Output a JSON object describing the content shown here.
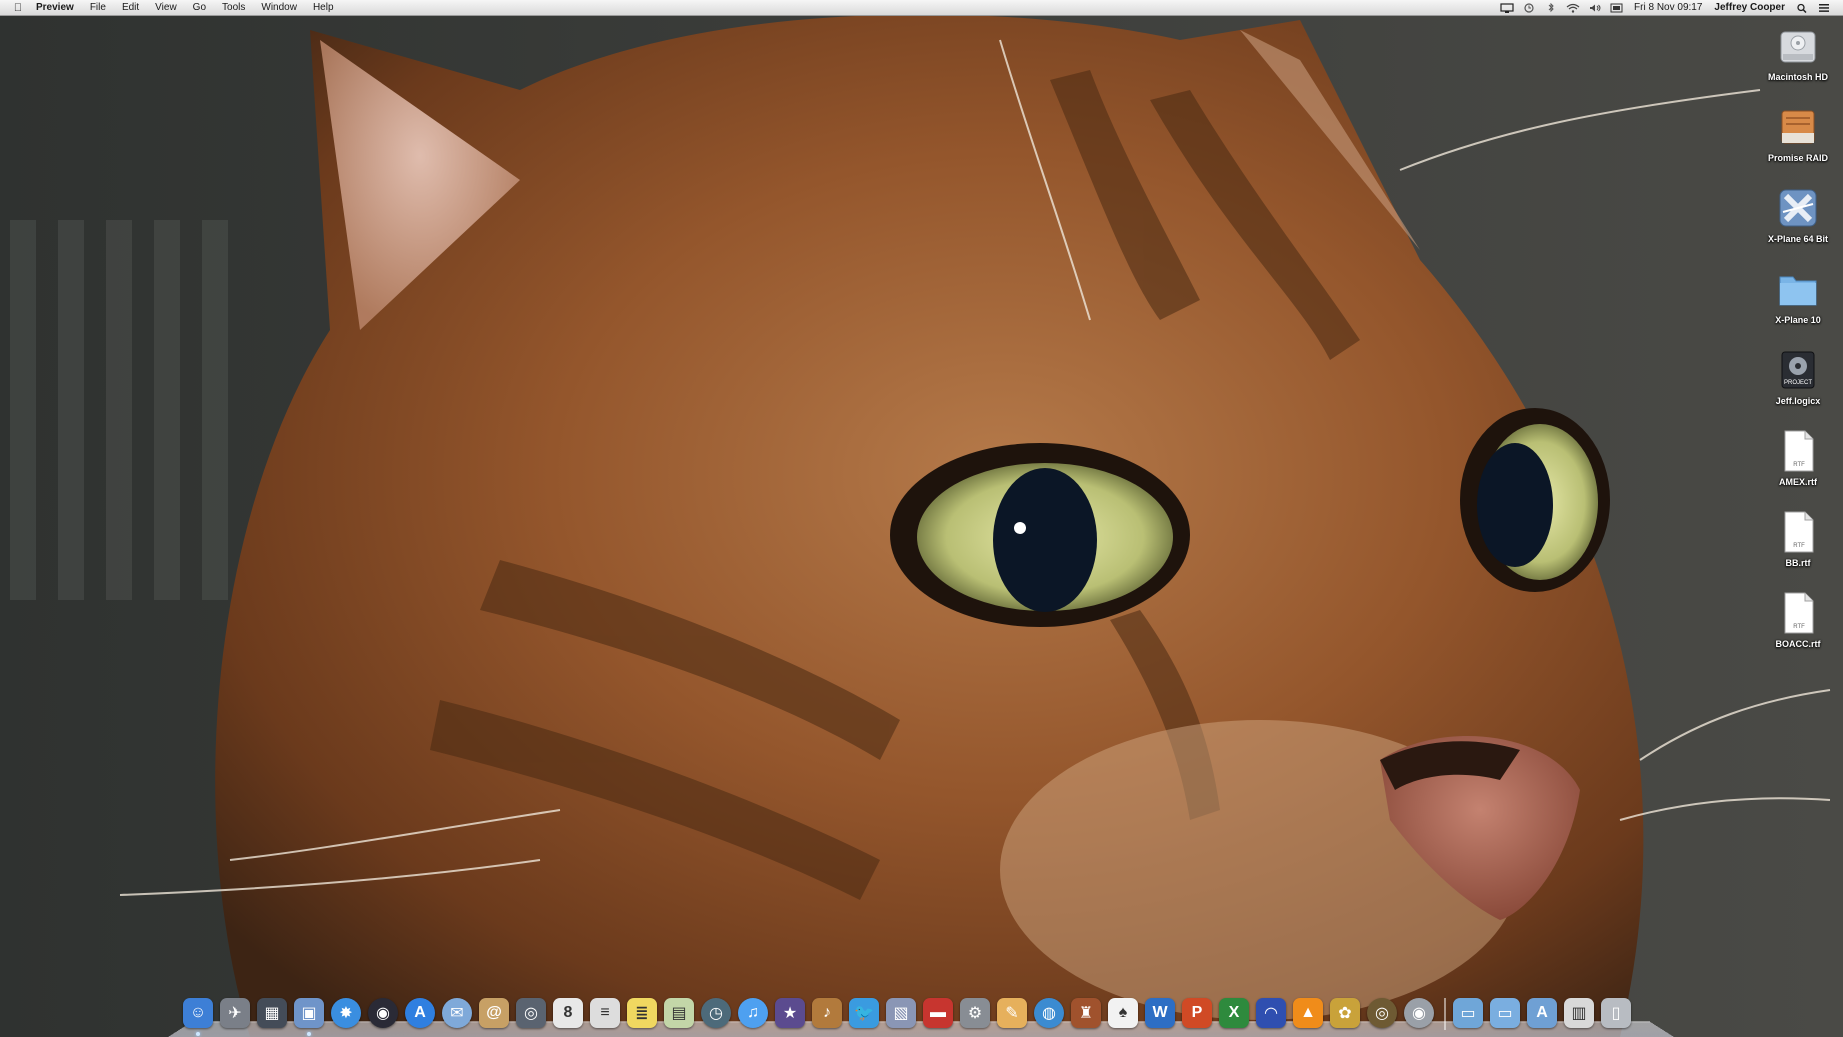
{
  "menubar": {
    "app_name": "Preview",
    "menus": [
      "File",
      "Edit",
      "View",
      "Go",
      "Tools",
      "Window",
      "Help"
    ],
    "clock": "Fri 8 Nov  09:17",
    "user": "Jeffrey Cooper",
    "status_icons": [
      "display-icon",
      "time-machine-icon",
      "bluetooth-icon",
      "wifi-icon",
      "volume-icon",
      "battery-icon"
    ]
  },
  "desktop": {
    "items": [
      {
        "label": "Macintosh HD",
        "icon": "hard-drive-icon"
      },
      {
        "label": "Promise RAID",
        "icon": "external-drive-icon"
      },
      {
        "label": "X-Plane 64 Bit",
        "icon": "xplane-app-icon"
      },
      {
        "label": "X-Plane 10",
        "icon": "folder-icon"
      },
      {
        "label": "Jeff.logicx",
        "icon": "logic-project-icon"
      },
      {
        "label": "AMEX.rtf",
        "icon": "rtf-document-icon"
      },
      {
        "label": "BB.rtf",
        "icon": "rtf-document-icon"
      },
      {
        "label": "BOACC.rtf",
        "icon": "rtf-document-icon"
      }
    ],
    "rtf_badge": "RTF",
    "project_badge": "PROJECT"
  },
  "dock": {
    "items": [
      {
        "icon": "finder-icon",
        "color": "#3d7fd6",
        "glyph": "☺",
        "running": true
      },
      {
        "icon": "launchpad-icon",
        "color": "#7a7f88",
        "glyph": "✈",
        "running": false
      },
      {
        "icon": "mission-control-icon",
        "color": "#444c58",
        "glyph": "▦",
        "running": false
      },
      {
        "icon": "preview-icon",
        "color": "#6f94c9",
        "glyph": "▣",
        "running": true
      },
      {
        "icon": "safari-icon",
        "color": "#3a8ee0",
        "glyph": "✸",
        "running": false,
        "round": true
      },
      {
        "icon": "aperture-icon",
        "color": "#2a2a36",
        "glyph": "◉",
        "running": false,
        "round": true
      },
      {
        "icon": "app-store-icon",
        "color": "#2f7fe0",
        "glyph": "A",
        "running": false,
        "round": true
      },
      {
        "icon": "mail-bird-icon",
        "color": "#7fa9d9",
        "glyph": "✉",
        "running": false,
        "round": true
      },
      {
        "icon": "address-book-icon",
        "color": "#c7a065",
        "glyph": "@",
        "running": false
      },
      {
        "icon": "facetime-icon",
        "color": "#5a6370",
        "glyph": "◎",
        "running": false
      },
      {
        "icon": "calendar-icon",
        "color": "#e8e8e8",
        "glyph": "8",
        "running": false
      },
      {
        "icon": "textedit-icon",
        "color": "#dddddd",
        "glyph": "≡",
        "running": false
      },
      {
        "icon": "stickies-icon",
        "color": "#f0d860",
        "glyph": "≣",
        "running": false
      },
      {
        "icon": "iphoto-icon",
        "color": "#c3d6a8",
        "glyph": "▤",
        "running": false
      },
      {
        "icon": "time-machine-icon",
        "color": "#4d6a7a",
        "glyph": "◷",
        "running": false,
        "round": true
      },
      {
        "icon": "itunes-icon",
        "color": "#4ea0f0",
        "glyph": "♫",
        "running": false,
        "round": true
      },
      {
        "icon": "imovie-icon",
        "color": "#5b4b8f",
        "glyph": "★",
        "running": false
      },
      {
        "icon": "garageband-icon",
        "color": "#b27a3c",
        "glyph": "♪",
        "running": false
      },
      {
        "icon": "twitter-icon",
        "color": "#3a9be0",
        "glyph": "🐦",
        "running": false
      },
      {
        "icon": "photo-booth-icon",
        "color": "#8a96b5",
        "glyph": "▧",
        "running": false
      },
      {
        "icon": "photo-stack-icon",
        "color": "#c7352f",
        "glyph": "▬",
        "running": false
      },
      {
        "icon": "system-preferences-icon",
        "color": "#888d94",
        "glyph": "⚙",
        "running": false
      },
      {
        "icon": "pages-icon",
        "color": "#e6b05c",
        "glyph": "✎",
        "running": false
      },
      {
        "icon": "network-globe-icon",
        "color": "#3b8bd1",
        "glyph": "◍",
        "running": false,
        "round": true
      },
      {
        "icon": "games-icon",
        "color": "#a0522d",
        "glyph": "♜",
        "running": false
      },
      {
        "icon": "solitaire-icon",
        "color": "#f2f2f2",
        "glyph": "♠",
        "running": false
      },
      {
        "icon": "word-icon",
        "color": "#2d6ec4",
        "glyph": "W",
        "running": false
      },
      {
        "icon": "powerpoint-icon",
        "color": "#d04a25",
        "glyph": "P",
        "running": false
      },
      {
        "icon": "excel-icon",
        "color": "#2e8a3d",
        "glyph": "X",
        "running": false
      },
      {
        "icon": "headphones-icon",
        "color": "#2f4fb0",
        "glyph": "◠",
        "running": false
      },
      {
        "icon": "vlc-icon",
        "color": "#f08c1a",
        "glyph": "▲",
        "running": false
      },
      {
        "icon": "pineapple-icon",
        "color": "#c9a23a",
        "glyph": "✿",
        "running": false
      },
      {
        "icon": "coin-icon",
        "color": "#6e5a33",
        "glyph": "◎",
        "running": false,
        "round": true
      },
      {
        "icon": "dvd-player-icon",
        "color": "#9aa0a8",
        "glyph": "◉",
        "running": false,
        "round": true
      },
      {
        "sep": true
      },
      {
        "icon": "applications-stack-icon",
        "color": "#6fa6d8",
        "glyph": "▭",
        "running": false
      },
      {
        "icon": "documents-stack-icon",
        "color": "#7aaee0",
        "glyph": "▭",
        "running": false
      },
      {
        "icon": "downloads-stack-icon",
        "color": "#6fa0d4",
        "glyph": "A",
        "running": false
      },
      {
        "icon": "finder-stack-icon",
        "color": "#d9d9d9",
        "glyph": "▥",
        "running": false
      },
      {
        "icon": "trash-icon",
        "color": "#b8bcc2",
        "glyph": "▯",
        "running": false
      }
    ]
  }
}
